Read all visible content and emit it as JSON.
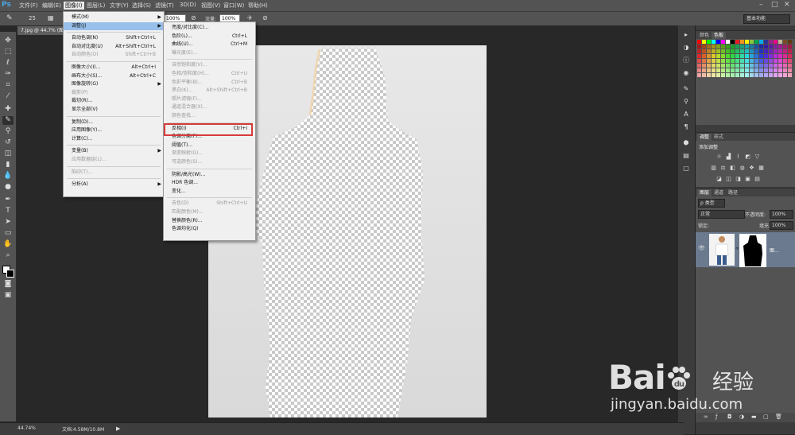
{
  "app": {
    "logo": "Ps"
  },
  "menubar": {
    "items": [
      "文件(F)",
      "编辑(E)",
      "图像(I)",
      "图层(L)",
      "文字(Y)",
      "选择(S)",
      "滤镜(T)",
      "3D(D)",
      "视图(V)",
      "窗口(W)",
      "帮助(H)"
    ],
    "active": "图像(I)"
  },
  "options": {
    "brush_size": "25",
    "opacity_label": "不透明度:",
    "opacity_value": "100%",
    "flow_label": "流量:",
    "flow_value": "100%",
    "workspace": "基本功能"
  },
  "document": {
    "tab_title": "7.jpg @ 44.7% (图层 1, 图层蒙版/8)",
    "zoom": "44.74%",
    "status": "文档:4.58M/10.8M"
  },
  "image_menu": {
    "items": [
      {
        "label": "模式(M)",
        "submenu": true
      },
      {
        "label": "调整(J)",
        "submenu": true,
        "highlight": true
      },
      {
        "sep": true
      },
      {
        "label": "自动色调(N)",
        "shortcut": "Shift+Ctrl+L"
      },
      {
        "label": "自动对比度(U)",
        "shortcut": "Alt+Shift+Ctrl+L"
      },
      {
        "label": "自动颜色(O)",
        "shortcut": "Shift+Ctrl+B",
        "disabled": true
      },
      {
        "sep": true
      },
      {
        "label": "图像大小(I)...",
        "shortcut": "Alt+Ctrl+I"
      },
      {
        "label": "画布大小(S)...",
        "shortcut": "Alt+Ctrl+C"
      },
      {
        "label": "图像旋转(G)",
        "submenu": true
      },
      {
        "label": "裁剪(P)",
        "disabled": true
      },
      {
        "label": "裁切(R)..."
      },
      {
        "label": "显示全部(V)"
      },
      {
        "sep": true
      },
      {
        "label": "复制(D)..."
      },
      {
        "label": "应用图像(Y)..."
      },
      {
        "label": "计算(C)..."
      },
      {
        "sep": true
      },
      {
        "label": "变量(B)",
        "submenu": true
      },
      {
        "label": "应用数据组(L)...",
        "disabled": true
      },
      {
        "sep": true
      },
      {
        "label": "陷印(T)...",
        "disabled": true
      },
      {
        "sep": true
      },
      {
        "label": "分析(A)",
        "submenu": true
      }
    ]
  },
  "adjust_menu": {
    "items": [
      {
        "label": "亮度/对比度(C)..."
      },
      {
        "label": "色阶(L)...",
        "shortcut": "Ctrl+L"
      },
      {
        "label": "曲线(U)...",
        "shortcut": "Ctrl+M"
      },
      {
        "label": "曝光度(E)...",
        "disabled": true
      },
      {
        "sep": true
      },
      {
        "label": "自然饱和度(V)...",
        "disabled": true
      },
      {
        "label": "色相/饱和度(H)...",
        "shortcut": "Ctrl+U",
        "disabled": true
      },
      {
        "label": "色彩平衡(B)...",
        "shortcut": "Ctrl+B",
        "disabled": true
      },
      {
        "label": "黑白(K)...",
        "shortcut": "Alt+Shift+Ctrl+B",
        "disabled": true
      },
      {
        "label": "照片滤镜(F)...",
        "disabled": true
      },
      {
        "label": "通道混合器(X)...",
        "disabled": true
      },
      {
        "label": "颜色查找...",
        "disabled": true
      },
      {
        "sep": true
      },
      {
        "label": "反相(I)",
        "shortcut": "Ctrl+I",
        "boxed": true
      },
      {
        "label": "色调分离(P)..."
      },
      {
        "label": "阈值(T)..."
      },
      {
        "label": "渐变映射(G)...",
        "disabled": true
      },
      {
        "label": "可选颜色(S)...",
        "disabled": true
      },
      {
        "sep": true
      },
      {
        "label": "阴影/高光(W)..."
      },
      {
        "label": "HDR 色调..."
      },
      {
        "label": "变化..."
      },
      {
        "sep": true
      },
      {
        "label": "去色(D)",
        "shortcut": "Shift+Ctrl+U",
        "disabled": true
      },
      {
        "label": "匹配颜色(M)...",
        "disabled": true
      },
      {
        "label": "替换颜色(R)..."
      },
      {
        "label": "色调均化(Q)"
      }
    ]
  },
  "panels": {
    "color_tabs": [
      "颜色",
      "色板"
    ],
    "adjust_tabs": [
      "调整",
      "样式"
    ],
    "adjust_title": "添加调整",
    "layers_tabs": [
      "图层",
      "通道",
      "路径"
    ],
    "layer_kind": "ρ 类型",
    "blend_mode": "正常",
    "opacity_label": "不透明度:",
    "opacity_value": "100%",
    "lock_label": "锁定:",
    "fill_label": "填充:",
    "fill_value": "100%",
    "layer_name": "图..."
  },
  "swatch_colors": [
    "#ff0000",
    "#ffff00",
    "#00ff00",
    "#00ffff",
    "#0000ff",
    "#ff00ff",
    "#ffffff",
    "#000000",
    "#ed1c24",
    "#f7941d",
    "#fff200",
    "#8dc63f",
    "#00a651",
    "#00aeef",
    "#2e3192",
    "#92278f",
    "#ec008c",
    "#c2b59b",
    "#754c24",
    "#603913"
  ],
  "watermark": {
    "logo": "Bai",
    "logo_tail": "du",
    "cn": "经验",
    "url": "jingyan.baidu.com"
  }
}
